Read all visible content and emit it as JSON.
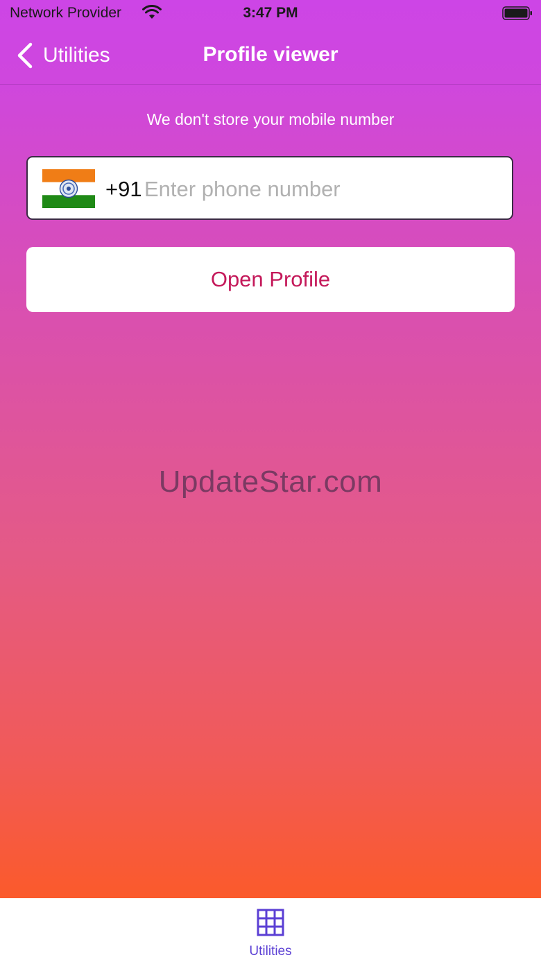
{
  "status_bar": {
    "carrier": "Network Provider",
    "time": "3:47 PM",
    "icons": [
      "wifi-icon",
      "battery-icon"
    ]
  },
  "nav": {
    "back_label": "Utilities",
    "title": "Profile viewer",
    "back_icon": "chevron-left-icon"
  },
  "content": {
    "privacy_note": "We don't store your mobile number",
    "phone": {
      "flag_icon": "india-flag-icon",
      "dial_code": "+91",
      "value": "",
      "placeholder": "Enter phone number"
    },
    "open_button_label": "Open Profile",
    "watermark": "UpdateStar.com"
  },
  "tab_bar": {
    "items": [
      {
        "label": "Utilities",
        "icon": "grid-icon",
        "selected": true
      }
    ]
  },
  "colors": {
    "gradient_top": "#cd45e6",
    "gradient_bottom": "#fb5a2b",
    "accent_button_text": "#c4195a",
    "tab_accent": "#5b3fd4"
  }
}
